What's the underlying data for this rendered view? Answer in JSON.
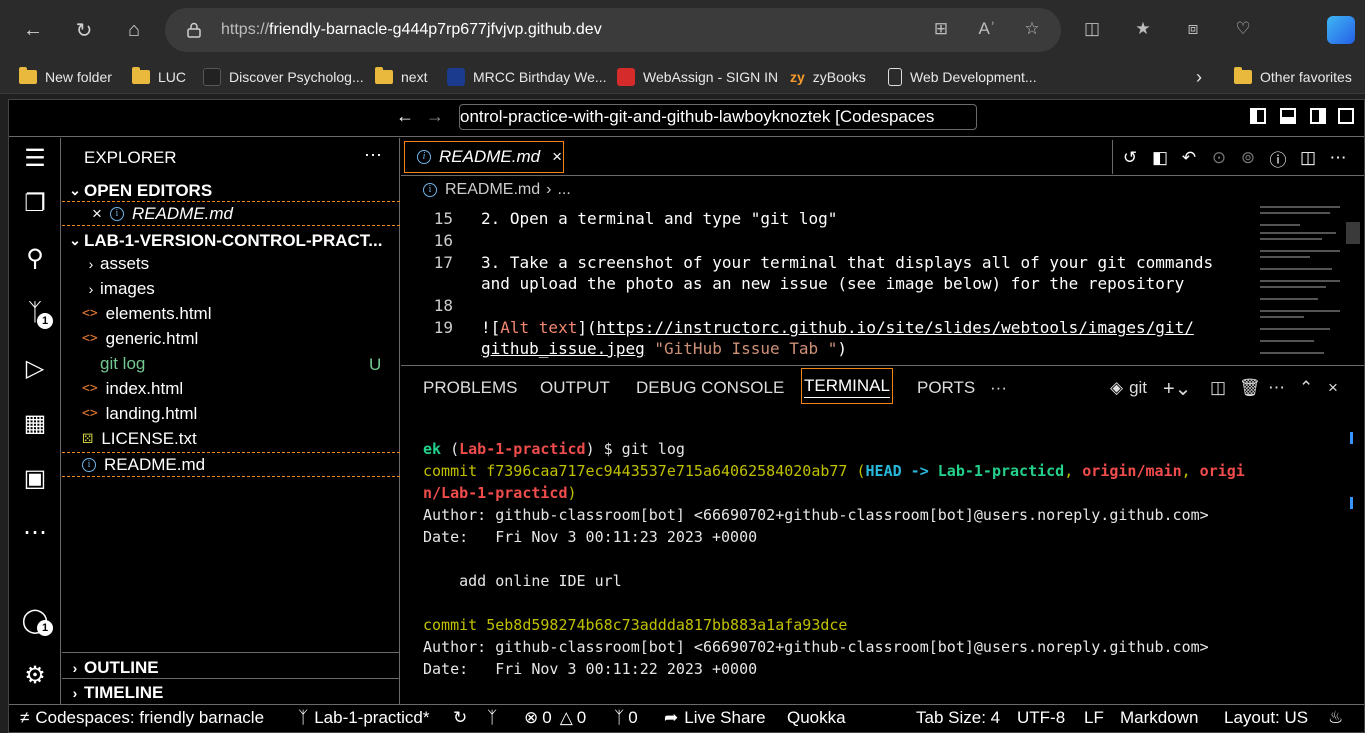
{
  "browser": {
    "url_prefix": "https://",
    "url_host": "friendly-barnacle-g444p7rp677jfvjvp.github.dev",
    "favorites": [
      {
        "label": "New folder",
        "icon": "folder-icon"
      },
      {
        "label": "LUC",
        "icon": "folder-icon"
      },
      {
        "label": "Discover Psycholog...",
        "icon": "site-icon"
      },
      {
        "label": "next",
        "icon": "folder-icon"
      },
      {
        "label": "MRCC Birthday We...",
        "icon": "site-icon"
      },
      {
        "label": "WebAssign - SIGN IN",
        "icon": "site-icon"
      },
      {
        "label": "zyBooks",
        "icon": "zy-icon"
      },
      {
        "label": "Web Development...",
        "icon": "page-icon"
      }
    ],
    "other_favorites": "Other favorites"
  },
  "vscode": {
    "title": "ontrol-practice-with-git-and-github-lawboyknoztek [Codespaces",
    "activity_badges": {
      "scm": "1",
      "accounts": "1"
    },
    "explorer": {
      "header": "EXPLORER",
      "open_editors": "OPEN EDITORS",
      "open_file": "README.md",
      "project": "LAB-1-VERSION-CONTROL-PRACT...",
      "items": [
        {
          "label": "assets",
          "type": "folder"
        },
        {
          "label": "images",
          "type": "folder"
        },
        {
          "label": "elements.html",
          "type": "html"
        },
        {
          "label": "generic.html",
          "type": "html"
        },
        {
          "label": "git log",
          "type": "git"
        },
        {
          "label": "index.html",
          "type": "html"
        },
        {
          "label": "landing.html",
          "type": "html"
        },
        {
          "label": "LICENSE.txt",
          "type": "license"
        },
        {
          "label": "README.md",
          "type": "info"
        }
      ],
      "git_log_status": "U",
      "outline": "OUTLINE",
      "timeline": "TIMELINE"
    },
    "editor": {
      "tab": "README.md",
      "breadcrumb": "README.md",
      "breadcrumb_more": "...",
      "lines": [
        {
          "n": "15",
          "text": "2. Open a terminal and type \"git log\""
        },
        {
          "n": "16",
          "text": ""
        },
        {
          "n": "17",
          "text": "3. Take a screenshot of your terminal that displays all of your git commands"
        },
        {
          "n": "",
          "text": "and upload the photo as an new issue (see image below) for the repository"
        },
        {
          "n": "18",
          "text": ""
        },
        {
          "n": "19",
          "text_a": "![",
          "text_b": "Alt text",
          "text_c": "](",
          "text_d": "https://instructorc.github.io/site/slides/webtools/images/git/"
        },
        {
          "n": "",
          "text_d2": "github_issue.jpeg",
          "text_e": " \"GitHub Issue Tab \"",
          "text_f": ")"
        }
      ]
    },
    "panel": {
      "tabs": [
        "PROBLEMS",
        "OUTPUT",
        "DEBUG CONSOLE",
        "TERMINAL",
        "PORTS",
        "···"
      ],
      "shell": "git"
    },
    "terminal": {
      "prompt_user": "ek",
      "prompt_branch_open": " (",
      "prompt_branch": "Lab-1-practicd",
      "prompt_branch_close": ")",
      "prompt_cmd": " $ git log",
      "c1_hash": "commit f7396caa717ec9443537e715a64062584020ab77",
      "c1_ref_open": " (",
      "c1_head": "HEAD ->",
      "c1_branch": " Lab-1-practicd",
      "c1_sep1": ",",
      "c1_origin_main": " origin/main",
      "c1_sep2": ",",
      "c1_origin_lab_a": " origi",
      "c1_origin_lab_b": "n/Lab-1-practicd",
      "c1_ref_close": ")",
      "c1_author": "Author: github-classroom[bot] <66690702+github-classroom[bot]@users.noreply.github.com>",
      "c1_date": "Date:   Fri Nov 3 00:11:23 2023 +0000",
      "c1_msg": "    add online IDE url",
      "c2_hash": "commit 5eb8d598274b68c73addda817bb883a1afa93dce",
      "c2_author": "Author: github-classroom[bot] <66690702+github-classroom[bot]@users.noreply.github.com>",
      "c2_date": "Date:   Fri Nov 3 00:11:22 2023 +0000"
    },
    "status": {
      "remote": "Codespaces: friendly barnacle",
      "branch": "Lab-1-practicd*",
      "errors": "0",
      "warnings": "0",
      "ports": "0",
      "live_share": "Live Share",
      "quokka": "Quokka",
      "tab_size": "Tab Size: 4",
      "encoding": "UTF-8",
      "eol": "LF",
      "language": "Markdown",
      "layout": "Layout: US"
    }
  },
  "colors": {
    "accent_border": "#f38518",
    "terminal_green": "#23d18b",
    "terminal_red": "#f14c4c",
    "terminal_yellow": "#e5e510"
  }
}
